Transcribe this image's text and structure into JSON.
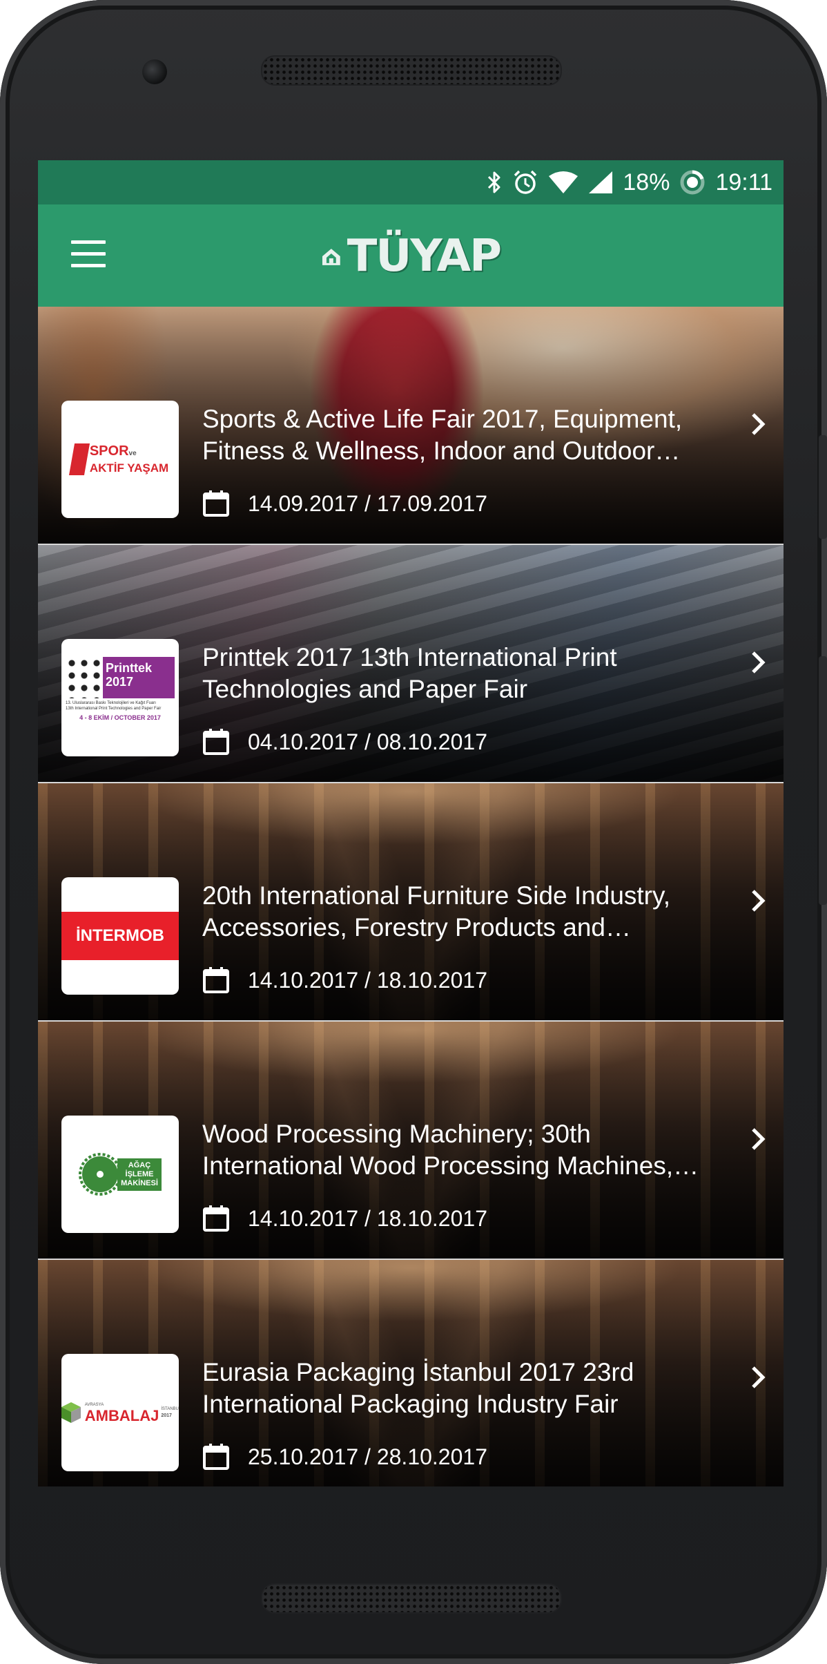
{
  "status_bar": {
    "battery": "18%",
    "time": "19:11",
    "icons": [
      "bluetooth-icon",
      "alarm-icon",
      "wifi-icon",
      "signal-icon",
      "battery-icon"
    ]
  },
  "app_bar": {
    "logo_text": "TÜYAP",
    "menu_icon": "hamburger-menu-icon",
    "color": "#2c9a6c",
    "status_color": "#207a57"
  },
  "events": [
    {
      "title": "Sports & Active Life Fair 2017, Equipment, Fitness & Wellness, Indoor and Outdoor Sports Fair",
      "date": "14.09.2017 / 17.09.2017",
      "logo": {
        "line1": "SPOR",
        "small": "ve",
        "line2": "AKTİF YAŞAM"
      }
    },
    {
      "title": "Printtek 2017 13th International Print Technologies and Paper Fair",
      "date": "04.10.2017 / 08.10.2017",
      "logo": {
        "name": "Printtek 2017",
        "line1": "13. Uluslararası Baskı Teknolojileri ve Kağıt Fuarı",
        "line2": "13th International Print Technologies and Paper Fair",
        "dates": "4 - 8 EKİM / OCTOBER 2017"
      }
    },
    {
      "title": "20th International Furniture Side Industry, Accessories, Forestry Products and Woodworking Fair",
      "date": "14.10.2017 / 18.10.2017",
      "logo": {
        "name": "İNTERMOB"
      }
    },
    {
      "title": "Wood Processing Machinery; 30th International Wood Processing Machines, Cutting Tools Fair",
      "date": "14.10.2017 / 18.10.2017",
      "logo": {
        "line1": "AĞAÇ",
        "line2": "İŞLEME",
        "line3": "MAKİNESİ"
      }
    },
    {
      "title": "Eurasia Packaging İstanbul 2017 23rd International Packaging Industry Fair",
      "date": "25.10.2017 / 28.10.2017",
      "logo": {
        "top": "AVRASYA",
        "name": "AMBALAJ",
        "side": "İSTANBUL",
        "year": "2017"
      }
    }
  ]
}
